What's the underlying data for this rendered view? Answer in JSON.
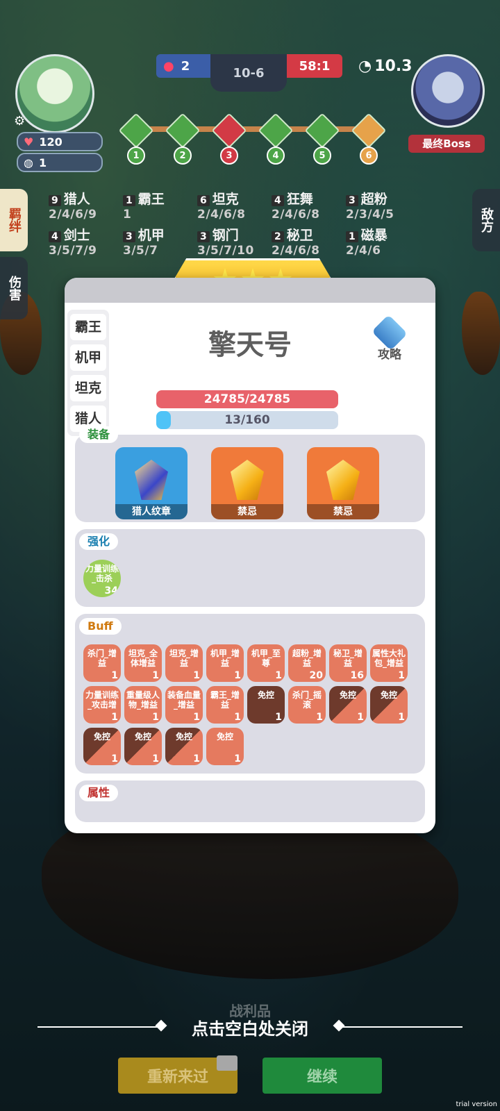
{
  "hud": {
    "lives": "120",
    "coins": "1",
    "team_score": "2",
    "round": "10-6",
    "enemy_score": "58:1",
    "timer": "10.3",
    "boss_label": "最终Boss",
    "stages": [
      "1",
      "2",
      "3",
      "4",
      "5",
      "6"
    ]
  },
  "side_tabs": {
    "bond": "羁绊",
    "damage": "伤害",
    "enemy": "敌方"
  },
  "traits": [
    {
      "count": "9",
      "name": "猎人",
      "levels": "2/4/6/9"
    },
    {
      "count": "1",
      "name": "霸王",
      "levels": "1"
    },
    {
      "count": "6",
      "name": "坦克",
      "levels": "2/4/6/8"
    },
    {
      "count": "4",
      "name": "狂舞",
      "levels": "2/4/6/8"
    },
    {
      "count": "3",
      "name": "超粉",
      "levels": "2/3/4/5"
    },
    {
      "count": "4",
      "name": "剑士",
      "levels": "3/5/7/9"
    },
    {
      "count": "3",
      "name": "机甲",
      "levels": "3/5/7"
    },
    {
      "count": "3",
      "name": "钢门",
      "levels": "3/5/7/10"
    },
    {
      "count": "2",
      "name": "秘卫",
      "levels": "2/4/6/8"
    },
    {
      "count": "1",
      "name": "磁暴",
      "levels": "2/4/6"
    }
  ],
  "modal": {
    "star_count": 3,
    "unit_name": "擎天号",
    "guide_label": "攻略",
    "tags": [
      "霸王",
      "机甲",
      "坦克",
      "猎人"
    ],
    "hp_text": "24785/24785",
    "hp_fraction": 1.0,
    "energy_text": "13/160",
    "energy_fraction": 0.08125,
    "equipment_label": "装备",
    "equipment": [
      "猎人纹章",
      "禁忌",
      "禁忌"
    ],
    "enhance_label": "强化",
    "enhance_item": {
      "title": "力量训练_击杀",
      "count": "34"
    },
    "buff_label": "Buff",
    "buffs": [
      {
        "title": "杀门_增益",
        "count": "1",
        "style": "light"
      },
      {
        "title": "坦克_全体增益",
        "count": "1",
        "style": "light"
      },
      {
        "title": "坦克_增益",
        "count": "1",
        "style": "light"
      },
      {
        "title": "机甲_增益",
        "count": "1",
        "style": "light"
      },
      {
        "title": "机甲_至尊",
        "count": "1",
        "style": "light"
      },
      {
        "title": "超粉_增益",
        "count": "20",
        "style": "light"
      },
      {
        "title": "秘卫_增益",
        "count": "16",
        "style": "light"
      },
      {
        "title": "属性大礼包_增益",
        "count": "1",
        "style": "light"
      },
      {
        "title": "力量训练_攻击增",
        "count": "1",
        "style": "light"
      },
      {
        "title": "重量级人物_增益",
        "count": "1",
        "style": "light"
      },
      {
        "title": "装备血量_增益",
        "count": "1",
        "style": "light"
      },
      {
        "title": "霸王_增益",
        "count": "1",
        "style": "light"
      },
      {
        "title": "免控",
        "count": "1",
        "style": "dark"
      },
      {
        "title": "杀门_摇滚",
        "count": "1",
        "style": "light"
      },
      {
        "title": "免控",
        "count": "1",
        "style": "half"
      },
      {
        "title": "免控",
        "count": "1",
        "style": "half"
      },
      {
        "title": "免控",
        "count": "1",
        "style": "half"
      },
      {
        "title": "免控",
        "count": "1",
        "style": "half"
      },
      {
        "title": "免控",
        "count": "1",
        "style": "half"
      },
      {
        "title": "免控",
        "count": "1",
        "style": "light"
      }
    ],
    "attr_label": "属性"
  },
  "bottom": {
    "close_hint": "点击空白处关闭",
    "loot_label": "战利品",
    "restart_label": "重新来过",
    "continue_label": "继续",
    "watermark": "trial version"
  },
  "colors": {
    "accent_gold": "#f5b51e",
    "hp": "#e8626a",
    "energy": "#4fc3f7",
    "restart": "#a98a1d",
    "continue": "#1f8a3c"
  }
}
